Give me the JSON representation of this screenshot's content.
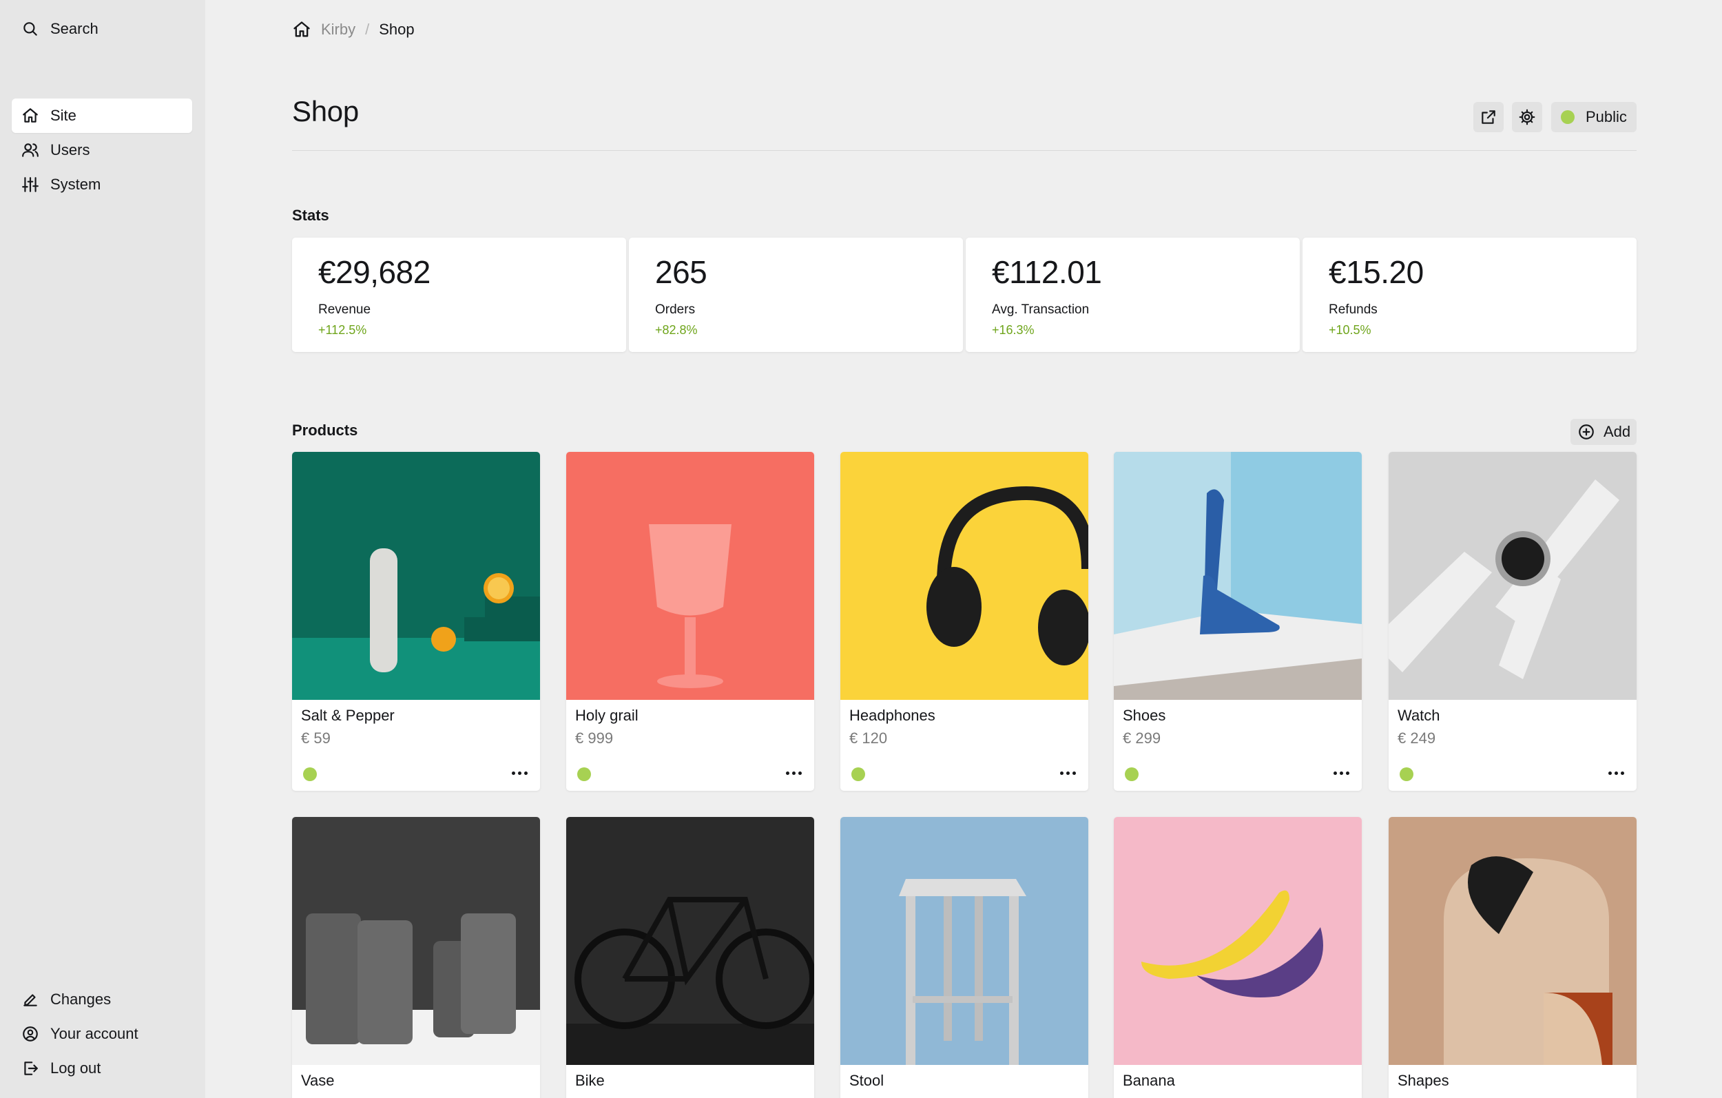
{
  "sidebar": {
    "search": "Search",
    "nav": [
      {
        "label": "Site",
        "icon": "home-icon",
        "active": true
      },
      {
        "label": "Users",
        "icon": "users-icon"
      },
      {
        "label": "System",
        "icon": "sliders-icon"
      }
    ],
    "footer": [
      {
        "label": "Changes",
        "icon": "pen-icon"
      },
      {
        "label": "Your account",
        "icon": "account-icon"
      },
      {
        "label": "Log out",
        "icon": "logout-icon"
      }
    ]
  },
  "breadcrumb": {
    "home": "Kirby",
    "current": "Shop"
  },
  "header": {
    "title": "Shop",
    "status": "Public"
  },
  "stats": {
    "label": "Stats",
    "items": [
      {
        "value": "€29,682",
        "label": "Revenue",
        "info": "+112.5%"
      },
      {
        "value": "265",
        "label": "Orders",
        "info": "+82.8%"
      },
      {
        "value": "€112.01",
        "label": "Avg. Transaction",
        "info": "+16.3%"
      },
      {
        "value": "€15.20",
        "label": "Refunds",
        "info": "+10.5%"
      }
    ]
  },
  "products": {
    "label": "Products",
    "add": "Add",
    "items": [
      {
        "title": "Salt & Pepper",
        "price": "€ 59"
      },
      {
        "title": "Holy grail",
        "price": "€ 999"
      },
      {
        "title": "Headphones",
        "price": "€ 120"
      },
      {
        "title": "Shoes",
        "price": "€ 299"
      },
      {
        "title": "Watch",
        "price": "€ 249"
      },
      {
        "title": "Vase",
        "price": ""
      },
      {
        "title": "Bike",
        "price": ""
      },
      {
        "title": "Stool",
        "price": ""
      },
      {
        "title": "Banana",
        "price": ""
      },
      {
        "title": "Shapes",
        "price": ""
      }
    ]
  },
  "colors": {
    "accent_green": "#a7d152",
    "positive": "#6fa51c"
  }
}
